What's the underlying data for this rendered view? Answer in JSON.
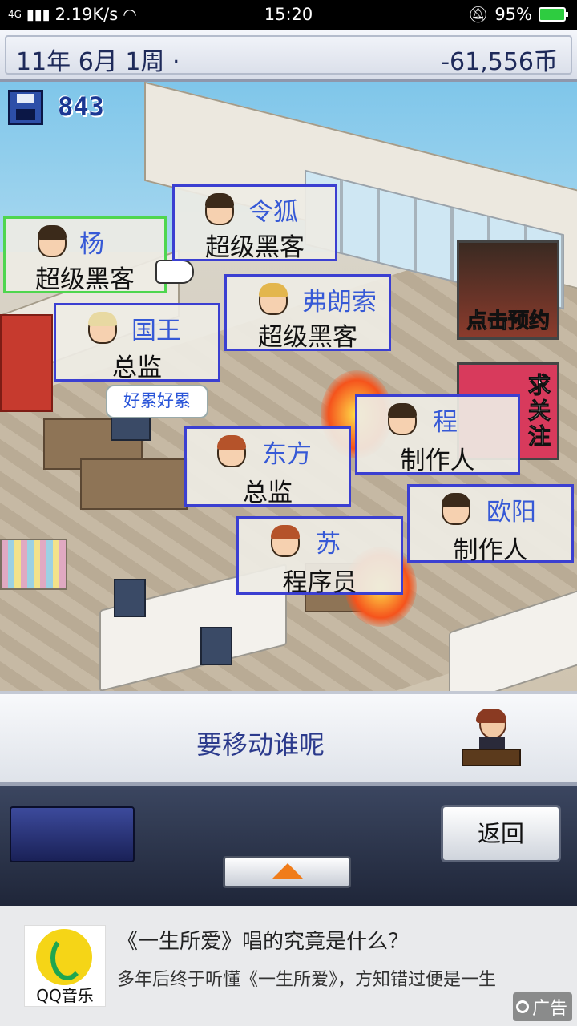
{
  "status_bar": {
    "network": "4G",
    "speed": "2.19K/s",
    "time": "15:20",
    "battery": "95%"
  },
  "header": {
    "date": "11年 6月 1周 ·",
    "funds": "-61,556币"
  },
  "save": {
    "count": "843"
  },
  "staff": [
    {
      "name": "杨",
      "job": "超级黑客",
      "selected": true
    },
    {
      "name": "令狐",
      "job": "超级黑客",
      "selected": false
    },
    {
      "name": "弗朗索",
      "job": "超级黑客",
      "selected": false
    },
    {
      "name": "国王",
      "job": "总监",
      "selected": false
    },
    {
      "name": "东方",
      "job": "总监",
      "selected": false
    },
    {
      "name": "程",
      "job": "制作人",
      "selected": false
    },
    {
      "name": "欧阳",
      "job": "制作人",
      "selected": false
    },
    {
      "name": "苏",
      "job": "程序员",
      "selected": false
    }
  ],
  "speech_bubble": "好累好累",
  "side_ads": {
    "card1": "点击预约",
    "card2": "求关注"
  },
  "prompt": {
    "text": "要移动谁呢"
  },
  "controls": {
    "back_label": "返回"
  },
  "ad_banner": {
    "logo_label": "QQ音乐",
    "title": "《一生所爱》唱的究竟是什么？",
    "description": "多年后终于听懂《一生所爱》，方知错过便是一生",
    "badge": "广告"
  }
}
